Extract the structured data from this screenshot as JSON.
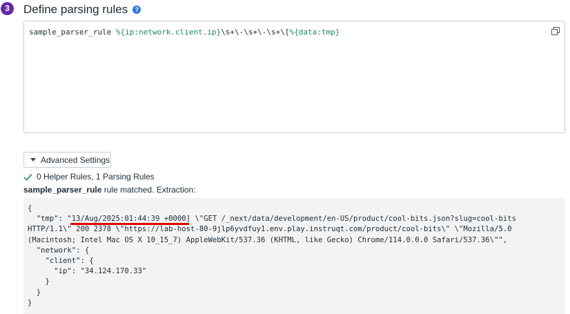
{
  "step": {
    "number": "3",
    "title": "Define parsing rules",
    "help_glyph": "?"
  },
  "editor": {
    "rule_name": "sample_parser_rule",
    "pattern_open": "%{ip:network.client.ip}",
    "regex1": "\\s+\\-\\s+\\-\\s+\\[",
    "pattern_close": "%{data:tmp}"
  },
  "advanced": {
    "label": "Advanced Settings"
  },
  "status": {
    "rules_summary": "0 Helper Rules, 1 Parsing Rules",
    "matched_rule": "sample_parser_rule",
    "matched_suffix": " rule matched. Extraction:"
  },
  "result": {
    "lines": [
      "{",
      "  \"tmp\": \"13/Aug/2025:01:44:39 +0000] \\\"GET /_next/data/development/en-US/product/cool-bits.json?slug=cool-bits",
      "HTTP/1.1\\\" 200 2378 \\\"https://lab-host-80-9jlp6yvdfuy1.env.play.instruqt.com/product/cool-bits\\\" \\\"Mozilla/5.0",
      "(Macintosh; Intel Mac OS X 10_15_7) AppleWebKit/537.36 (KHTML, like Gecko) Chrome/114.0.0.0 Safari/537.36\\\"\",",
      "  \"network\": {",
      "    \"client\": {",
      "      \"ip\": \"34.124.170.33\"",
      "    }",
      "  }",
      "}"
    ]
  },
  "colors": {
    "badge": "#632ca6",
    "help": "#3277de",
    "pattern": "#1d8c54",
    "check": "#3ca46c",
    "annotation": "#e00000"
  }
}
